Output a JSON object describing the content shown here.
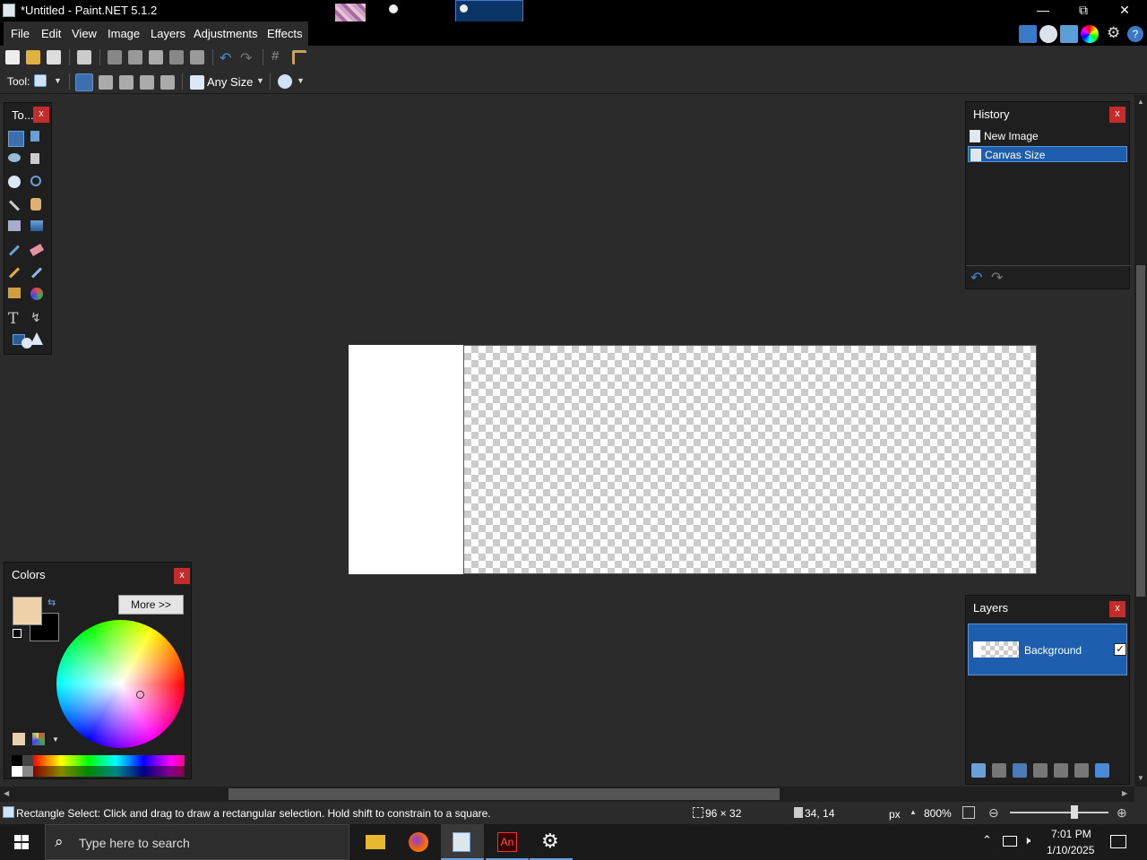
{
  "window": {
    "title": "*Untitled - Paint.NET 5.1.2",
    "minimize": "—",
    "restore": "⧉",
    "close": "✕"
  },
  "menu": {
    "items": [
      "File",
      "Edit",
      "View",
      "Image",
      "Layers",
      "Adjustments",
      "Effects"
    ]
  },
  "tool_options": {
    "tool_label": "Tool:",
    "brush_size": "Any Size"
  },
  "tools_panel": {
    "title": "To..."
  },
  "history": {
    "title": "History",
    "items": [
      "New Image",
      "Canvas Size"
    ],
    "selected_index": 1
  },
  "colors": {
    "title": "Colors",
    "more_button": "More >>",
    "primary": "#f0d2a8",
    "secondary": "#000000"
  },
  "layers": {
    "title": "Layers",
    "items": [
      {
        "name": "Background",
        "visible": true
      }
    ]
  },
  "status": {
    "hint": "Rectangle Select: Click and drag to draw a rectangular selection. Hold shift to constrain to a square.",
    "selection_size": "96 × 32",
    "cursor_pos": "34, 14",
    "units": "px",
    "zoom": "800%"
  },
  "taskbar": {
    "search_placeholder": "Type here to search",
    "time": "7:01 PM",
    "date": "1/10/2025"
  },
  "icons": [
    "new-file-icon",
    "open-icon",
    "save-icon",
    "print-icon",
    "cut-icon",
    "copy-icon",
    "paste-icon",
    "crop-icon",
    "deselect-icon",
    "undo-icon",
    "redo-icon",
    "grid-icon",
    "ruler-icon",
    "tools-icon",
    "history-icon",
    "layers-icon",
    "colors-icon",
    "settings-icon",
    "help-icon"
  ]
}
